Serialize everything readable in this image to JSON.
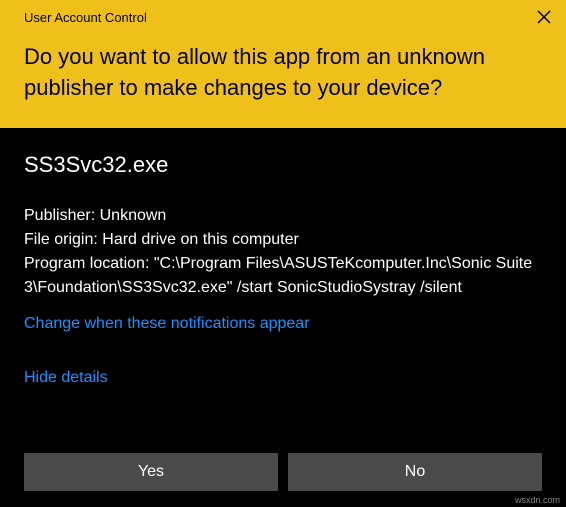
{
  "titlebar": {
    "title": "User Account Control"
  },
  "header": {
    "question": "Do you want to allow this app from an unknown publisher to make changes to your device?"
  },
  "body": {
    "app_name": "SS3Svc32.exe",
    "publisher_label": "Publisher:",
    "publisher_value": "Unknown",
    "origin_label": "File origin:",
    "origin_value": "Hard drive on this computer",
    "location_label": "Program location:",
    "location_value": "\"C:\\Program Files\\ASUSTeKcomputer.Inc\\Sonic Suite 3\\Foundation\\SS3Svc32.exe\" /start SonicStudioSystray /silent",
    "notifications_link": "Change when these notifications appear",
    "hide_details_link": "Hide details"
  },
  "buttons": {
    "yes": "Yes",
    "no": "No"
  },
  "watermark": "wsxdn.com"
}
